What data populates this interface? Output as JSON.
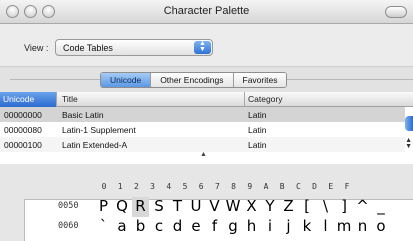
{
  "window": {
    "title": "Character Palette"
  },
  "view": {
    "label": "View :",
    "value": "Code Tables"
  },
  "tabs": [
    {
      "label": "Unicode",
      "active": true
    },
    {
      "label": "Other Encodings",
      "active": false
    },
    {
      "label": "Favorites",
      "active": false
    }
  ],
  "table": {
    "columns": [
      "Unicode",
      "Title",
      "Category"
    ],
    "rows": [
      {
        "code": "00000000",
        "title": "Basic Latin",
        "category": "Latin",
        "selected": true
      },
      {
        "code": "00000080",
        "title": "Latin-1 Supplement",
        "category": "Latin",
        "selected": false
      },
      {
        "code": "00000100",
        "title": "Latin Extended-A",
        "category": "Latin",
        "selected": false
      }
    ]
  },
  "grid": {
    "hex_headers": [
      "0",
      "1",
      "2",
      "3",
      "4",
      "5",
      "6",
      "7",
      "8",
      "9",
      "A",
      "B",
      "C",
      "D",
      "E",
      "F"
    ],
    "rows": [
      {
        "label": "0050",
        "glyphs": [
          "P",
          "Q",
          "R",
          "S",
          "T",
          "U",
          "V",
          "W",
          "X",
          "Y",
          "Z",
          "[",
          "\\",
          "]",
          "^",
          "_"
        ],
        "selected_index": 2
      },
      {
        "label": "0060",
        "glyphs": [
          "`",
          "a",
          "b",
          "c",
          "d",
          "e",
          "f",
          "g",
          "h",
          "i",
          "j",
          "k",
          "l",
          "m",
          "n",
          "o"
        ],
        "selected_index": -1
      }
    ]
  },
  "colors": {
    "accent": "#2c6bcf",
    "selection": "#d4d4d4"
  }
}
